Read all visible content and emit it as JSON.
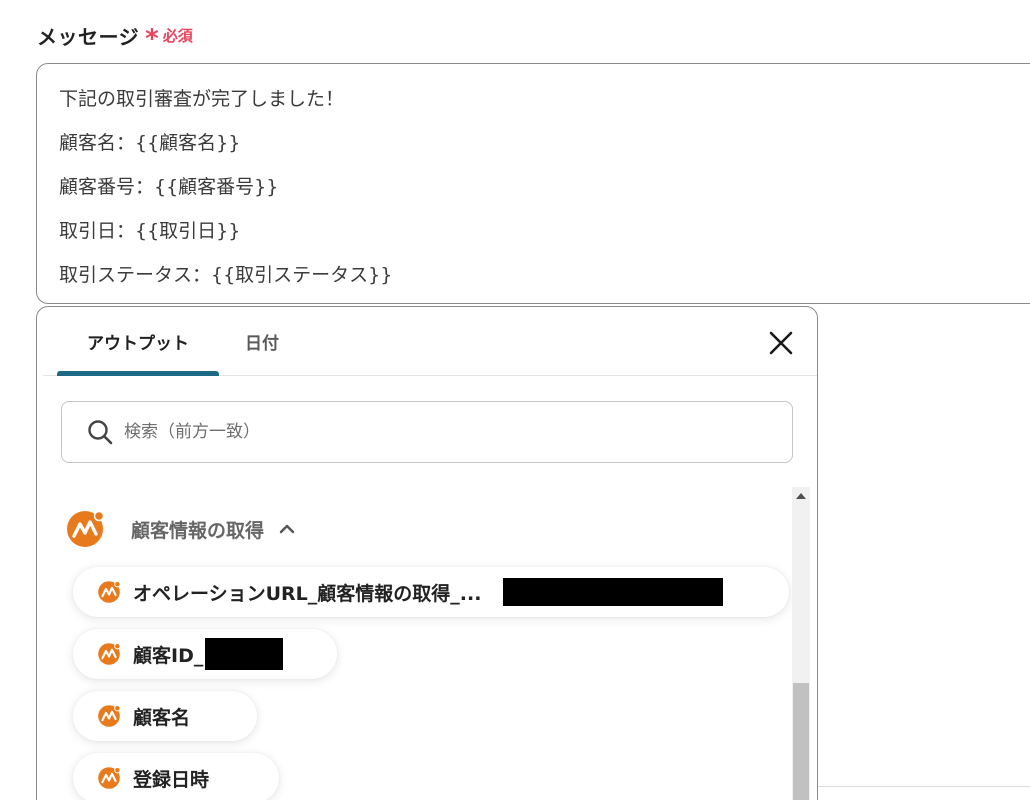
{
  "field": {
    "label": "メッセージ",
    "required_mark": "*",
    "required_text": "必須"
  },
  "message": {
    "lines": [
      "下記の取引審査が完了しました！",
      "顧客名：{{顧客名}}",
      "顧客番号：{{顧客番号}}",
      "取引日：{{取引日}}",
      "取引ステータス：{{取引ステータス}}"
    ]
  },
  "popup": {
    "tabs": [
      {
        "label": "アウトプット",
        "active": true
      },
      {
        "label": "日付",
        "active": false
      }
    ],
    "search": {
      "placeholder": "検索（前方一致）",
      "value": ""
    },
    "group": {
      "title": "顧客情報の取得",
      "expanded": true,
      "icon": "app-logo-icon"
    },
    "items": [
      {
        "label": "オペレーションURL_顧客情報の取得_...",
        "redacted": true
      },
      {
        "label": "顧客ID_",
        "redacted": true
      },
      {
        "label": "顧客名",
        "redacted": false
      },
      {
        "label": "登録日時",
        "redacted": false
      }
    ]
  },
  "colors": {
    "required": "#e8455f",
    "tab_indicator": "#1e6a84",
    "app_logo": "#e87a1e"
  }
}
